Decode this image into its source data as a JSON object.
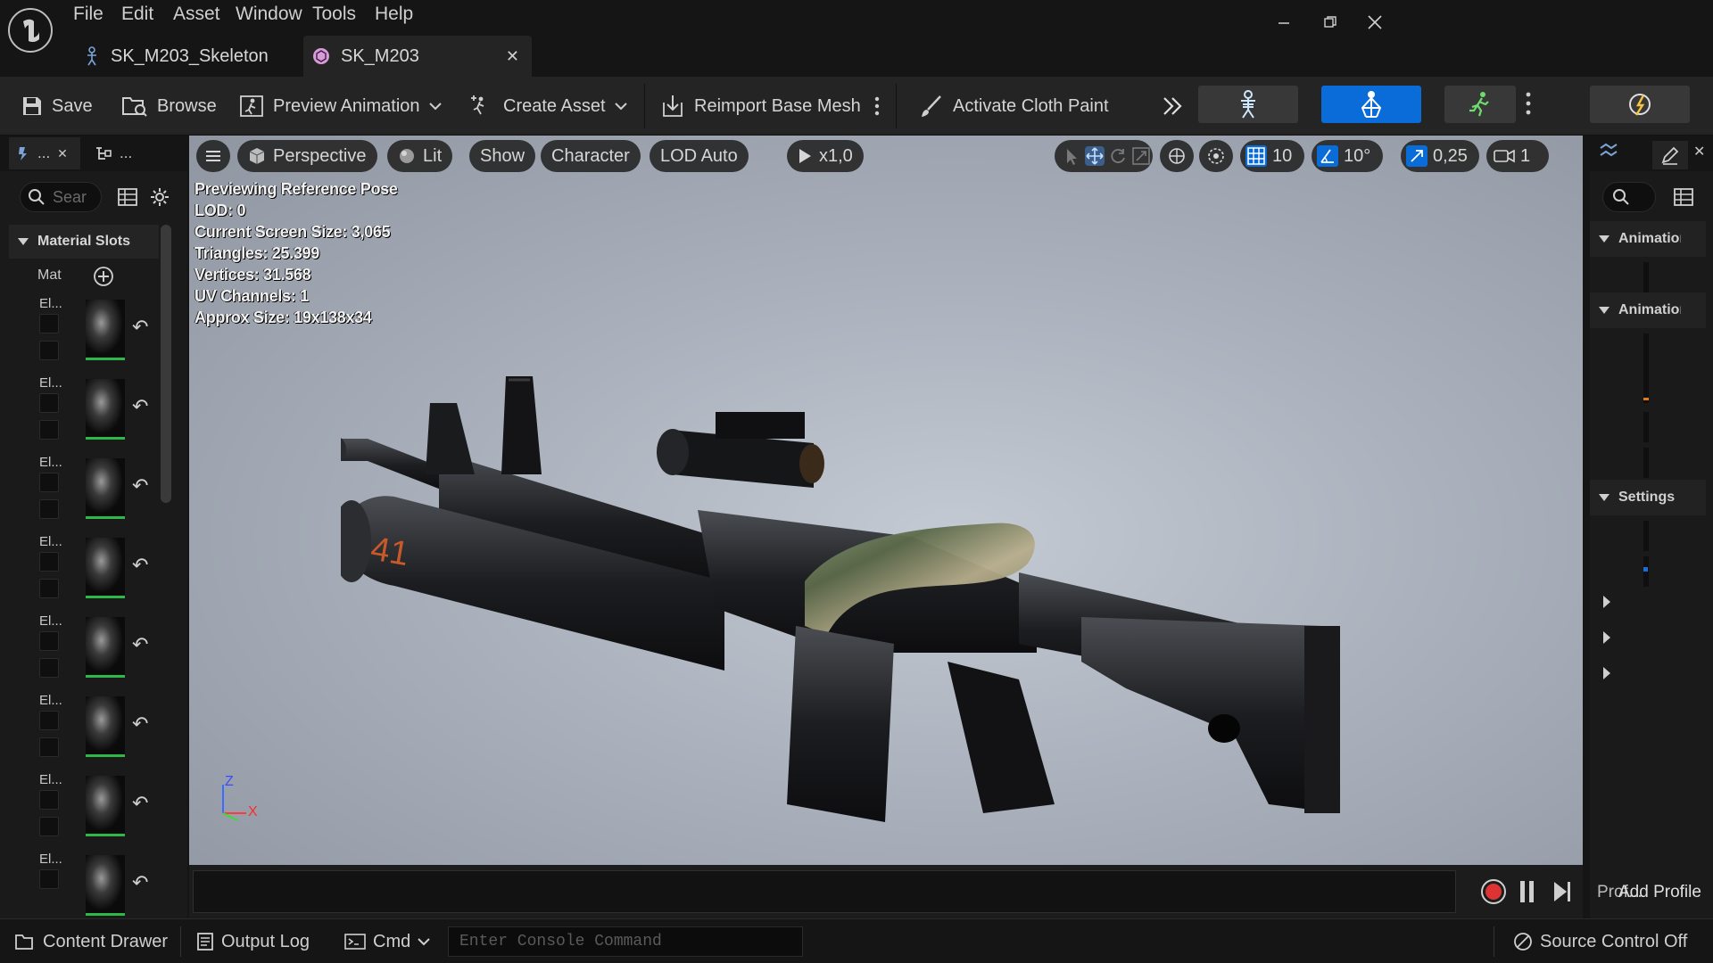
{
  "menu": [
    "File",
    "Edit",
    "Asset",
    "Window",
    "Tools",
    "Help"
  ],
  "tabs": [
    {
      "label": "SK_M203_Skeleton"
    },
    {
      "label": "SK_M203"
    }
  ],
  "toolbar": {
    "save": "Save",
    "browse": "Browse",
    "preview_animation": "Preview Animation",
    "create_asset": "Create Asset",
    "reimport": "Reimport Base Mesh",
    "cloth_paint": "Activate Cloth Paint"
  },
  "left_panel": {
    "tab1": "...",
    "tab2": "...",
    "search_placeholder": "Sear",
    "section": "Material Slots",
    "mat_label": "Mat",
    "element_label": "El..."
  },
  "viewport": {
    "view_mode": "Perspective",
    "lighting": "Lit",
    "show": "Show",
    "character": "Character",
    "lod": "LOD Auto",
    "play_rate": "x1,0",
    "grid_snap": "10",
    "rot_snap": "10°",
    "scale_snap": "0,25",
    "cam_speed": "1",
    "stats": [
      "Previewing Reference Pose",
      "LOD: 0",
      "Current Screen Size: 3,065",
      "Triangles: 25.399",
      "Vertices: 31.568",
      "UV Channels: 1",
      "Approx Size: 19x138x34"
    ],
    "axis": {
      "z": "Z",
      "x": "X"
    },
    "decal_number": "41"
  },
  "right_panel": {
    "sections": [
      "Animation",
      "Animation",
      "Settings"
    ],
    "footer": "Add Profile",
    "footer_under": "Prof..."
  },
  "statusbar": {
    "content_drawer": "Content Drawer",
    "output_log": "Output Log",
    "cmd": "Cmd",
    "console_placeholder": "Enter Console Command",
    "source_control": "Source Control Off"
  },
  "colors": {
    "accent_blue": "#0a6cd8",
    "green_bar": "#2fb84a",
    "record_red": "#d33"
  }
}
